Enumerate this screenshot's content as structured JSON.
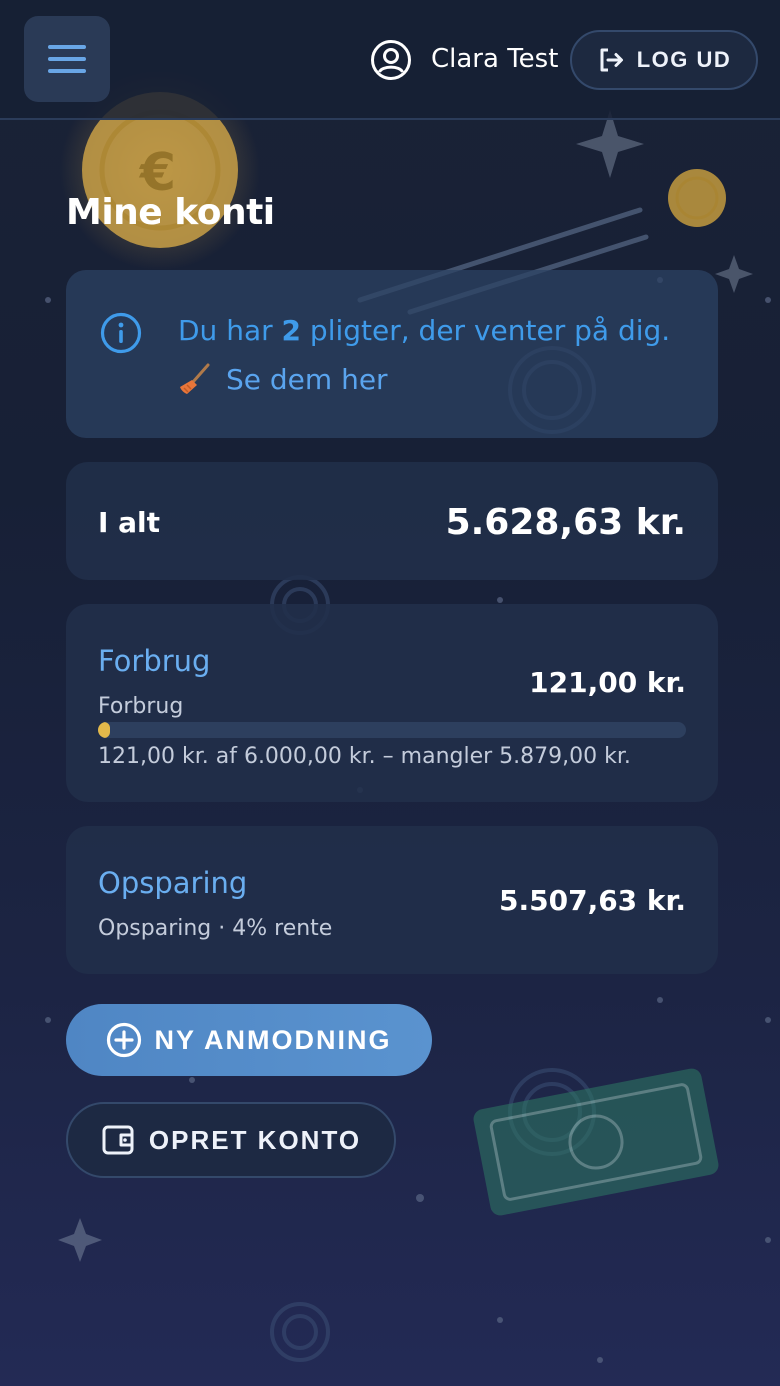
{
  "header": {
    "user_name": "Clara Test",
    "logout_label": "LOG UD"
  },
  "page": {
    "title": "Mine konti"
  },
  "notice": {
    "prefix": "Du har ",
    "count": "2",
    "suffix": " pligter, der venter på dig.",
    "link_label": "Se dem her"
  },
  "total": {
    "label": "I alt",
    "value": "5.628,63 kr."
  },
  "accounts": [
    {
      "name": "Forbrug",
      "subtitle": "Forbrug",
      "amount": "121,00 kr.",
      "progress_text": "121,00 kr. af 6.000,00 kr. – mangler 5.879,00 kr.",
      "progress_fraction": 0.02
    },
    {
      "name": "Opsparing",
      "subtitle": "Opsparing · 4% rente",
      "amount": "5.507,63 kr."
    }
  ],
  "actions": {
    "new_request_label": "NY ANMODNING",
    "create_account_label": "OPRET KONTO"
  },
  "decor": {
    "coin_symbol": "€"
  },
  "colors": {
    "accent": "#3f9bea",
    "link": "#6aaef0",
    "progress": "#e2b84a",
    "primary_button": "#5289c7"
  }
}
